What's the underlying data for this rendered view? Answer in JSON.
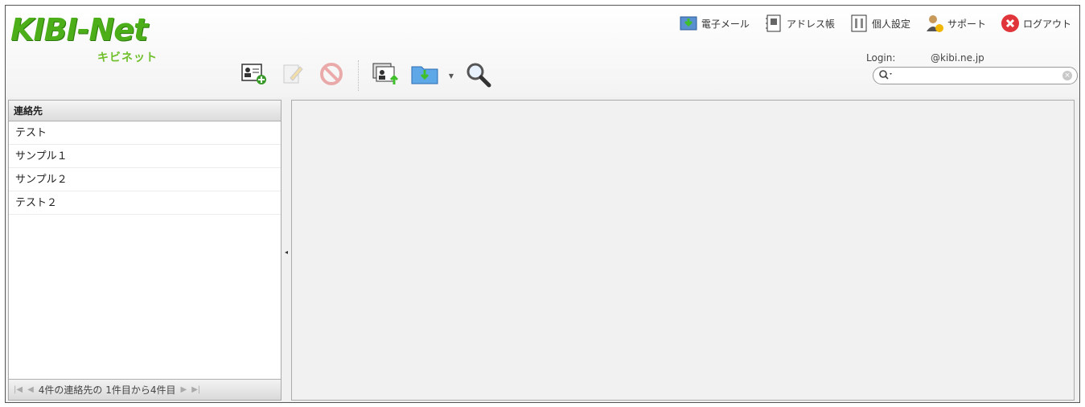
{
  "logo": {
    "main": "KIBI-Net",
    "sub": "キビネット"
  },
  "topnav": [
    {
      "label": "電子メール",
      "icon": "mail-download-icon"
    },
    {
      "label": "アドレス帳",
      "icon": "address-book-icon"
    },
    {
      "label": "個人設定",
      "icon": "settings-panel-icon"
    },
    {
      "label": "サポート",
      "icon": "support-person-icon"
    },
    {
      "label": "ログアウト",
      "icon": "logout-x-icon"
    }
  ],
  "toolbar": {
    "buttons": [
      {
        "icon": "add-contact-icon"
      },
      {
        "icon": "edit-contact-icon"
      },
      {
        "icon": "delete-contact-icon"
      },
      {
        "icon": "export-contacts-icon"
      },
      {
        "icon": "import-contacts-icon"
      },
      {
        "icon": "search-magnifier-icon"
      }
    ]
  },
  "login": {
    "label": "Login:",
    "value": "@kibi.ne.jp"
  },
  "search": {
    "value": "",
    "placeholder": ""
  },
  "contacts": {
    "header": "連絡先",
    "items": [
      "テスト",
      "サンプル１",
      "サンプル２",
      "テスト２"
    ]
  },
  "pager": {
    "text": "4件の連絡先の 1件目から4件目"
  },
  "colors": {
    "accent_green": "#4caf1a",
    "panel_bg": "#f1f1f1",
    "border": "#aaaaaa"
  }
}
